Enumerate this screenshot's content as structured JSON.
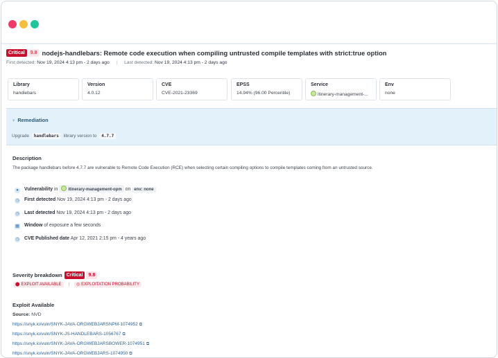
{
  "severity": {
    "label": "Critical",
    "score": "9.8"
  },
  "title": "nodejs-handlebars: Remote code execution when compiling untrusted compile templates with strict:true option",
  "first_detected": {
    "label": "First detected:",
    "value": "Nov 19, 2024 4:13 pm - 2 days ago"
  },
  "last_detected": {
    "label": "Last detected:",
    "value": "Nov 19, 2024 4:13 pm - 2 days ago"
  },
  "cards": [
    {
      "label": "Library",
      "value": "handlebars"
    },
    {
      "label": "Version",
      "value": "4.0.12"
    },
    {
      "label": "CVE",
      "value": "CVE-2021-23369"
    },
    {
      "label": "EPSS",
      "value": "14.94% (96.00 Percentile)"
    },
    {
      "label": "Service",
      "value": "itinerary-management-..."
    },
    {
      "label": "Env",
      "value": "none"
    }
  ],
  "remediation": {
    "title": "Remediation",
    "prefix": "Upgrade",
    "library": "handlebars",
    "middle": "library version to",
    "version": "4.7.7"
  },
  "description": {
    "heading": "Description",
    "text": "The package handlebars before 4.7.7 are vulnerable to Remote Code Execution (RCE) when selecting certain compiling options to compile templates coming from an untrusted source."
  },
  "meta": {
    "vulnerability": {
      "label": "Vulnerability",
      "in": "in",
      "service": "itinerary-management-opm",
      "on": "on",
      "env": "env: none"
    },
    "first_detected": {
      "label": "First detected",
      "value": "Nov 19, 2024 4:13 pm - 2 days ago"
    },
    "last_detected": {
      "label": "Last detected",
      "value": "Nov 19, 2024 4:13 pm - 2 days ago"
    },
    "window": {
      "label": "Window",
      "value": "of exposure a few seconds"
    },
    "cve_published": {
      "label": "CVE Published date",
      "value": "Apr 12, 2021 2:15 pm - 4 years ago"
    }
  },
  "severity_breakdown": {
    "heading": "Severity breakdown",
    "tag1": "EXPLOIT AVAILABLE",
    "separator": "|",
    "tag2": "EXPLOITATION PROBABILITY"
  },
  "exploit": {
    "heading": "Exploit Available",
    "source_label": "Source:",
    "source_value": "NVD",
    "links": [
      "https://snyk.io/vuln/SNYK-JAVA-ORGWEBJARSNPM-1074952",
      "https://snyk.io/vuln/SNYK-JS-HANDLEBARS-1056767",
      "https://snyk.io/vuln/SNYK-JAVA-ORGWEBJARSBOWER-1074951",
      "https://snyk.io/vuln/SNYK-JAVA-ORGWEBJARS-1074950"
    ]
  },
  "colors": {
    "critical": "#c8102e",
    "remediation_bg": "#e3f1fa",
    "link": "#2f5f95"
  }
}
